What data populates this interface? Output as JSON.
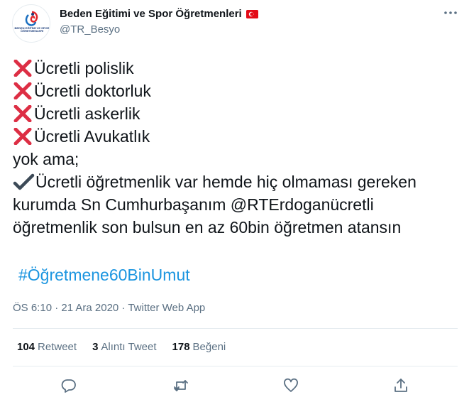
{
  "author": {
    "display_name": "Beden Eğitimi ve Spor Öğretmenleri",
    "handle": "@TR_Besyo",
    "avatar_text": "BEDEN EĞİTİMİ VE SPOR ÖĞRETMENLERİ"
  },
  "tweet": {
    "lines": [
      "Ücretli polislik",
      "Ücretli doktorluk",
      "Ücretli askerlik",
      "Ücretli Avukatlık",
      "yok ama;",
      "Ücretli öğretmenlik var hemde hiç olmaması gereken",
      "kurumda Sn Cumhurbaşanım @RTErdoganücretli",
      "öğretmenlik son bulsun en az 60bin öğretmen atansın"
    ],
    "hashtag": "#Öğretmene60BinUmut",
    "meta": "ÖS 6:10 · 21 Ara 2020 · Twitter Web App"
  },
  "stats": {
    "retweets_count": "104",
    "retweets_label": "Retweet",
    "quotes_count": "3",
    "quotes_label": "Alıntı Tweet",
    "likes_count": "178",
    "likes_label": "Beğeni"
  },
  "icons": {
    "more": "more-icon",
    "reply": "reply-icon",
    "retweet": "retweet-icon",
    "like": "like-icon",
    "share": "share-icon",
    "cross": "cross-mark-icon",
    "check": "check-mark-icon",
    "flag": "turkey-flag-icon"
  },
  "colors": {
    "text": "#0f1419",
    "secondary": "#5b7083",
    "link": "#1b95e0",
    "cross": "#dd2e44",
    "flag": "#e30a17"
  }
}
